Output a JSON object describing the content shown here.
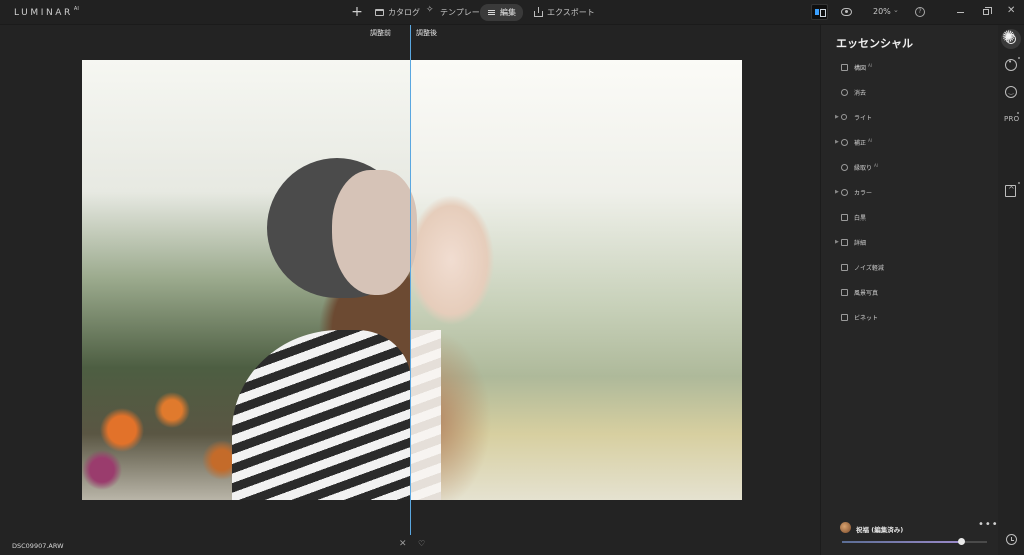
{
  "app": {
    "logo": "LUMINAR",
    "logo_version": "AI"
  },
  "topbar": {
    "add_label": "+",
    "tabs": [
      {
        "label": "カタログ",
        "icon": "folder-icon"
      },
      {
        "label": "テンプレート",
        "icon": "sparkle-icon"
      },
      {
        "label": "編集",
        "icon": "sliders-icon",
        "active": true
      },
      {
        "label": "エクスポート",
        "icon": "export-icon"
      }
    ],
    "zoom": "20%",
    "info": "?",
    "close": "✕"
  },
  "canvas": {
    "before_label": "調整前",
    "after_label": "調整後",
    "filename": "DSC09907.ARW",
    "reject": "✕",
    "favorite": "♡"
  },
  "panel": {
    "title": "エッセンシャル",
    "ai_badge": "AI",
    "tools": [
      {
        "label": "構図",
        "ai": true,
        "expandable": false,
        "icon": "crop-icon"
      },
      {
        "label": "消去",
        "ai": false,
        "expandable": false,
        "icon": "eraser-icon"
      },
      {
        "label": "ライト",
        "ai": false,
        "expandable": true,
        "icon": "light-icon"
      },
      {
        "label": "補正",
        "ai": true,
        "expandable": true,
        "icon": "enhance-icon"
      },
      {
        "label": "縁取り",
        "ai": true,
        "expandable": false,
        "icon": "structure-icon"
      },
      {
        "label": "カラー",
        "ai": false,
        "expandable": true,
        "icon": "color-icon"
      },
      {
        "label": "白黒",
        "ai": false,
        "expandable": false,
        "icon": "bw-icon"
      },
      {
        "label": "詳細",
        "ai": false,
        "expandable": true,
        "icon": "details-icon"
      },
      {
        "label": "ノイズ軽減",
        "ai": false,
        "expandable": false,
        "icon": "denoise-icon"
      },
      {
        "label": "風景写真",
        "ai": false,
        "expandable": false,
        "icon": "landscape-icon"
      },
      {
        "label": "ビネット",
        "ai": false,
        "expandable": false,
        "icon": "vignette-icon"
      }
    ],
    "preset": {
      "name": "祝福 (編集済み)",
      "more": "•••",
      "amount": 0.82
    }
  },
  "rail": {
    "pro_label": "PRO"
  },
  "colors": {
    "accent": "#3aa0ff",
    "split_line": "#5aa7e0",
    "background": "#232323"
  }
}
